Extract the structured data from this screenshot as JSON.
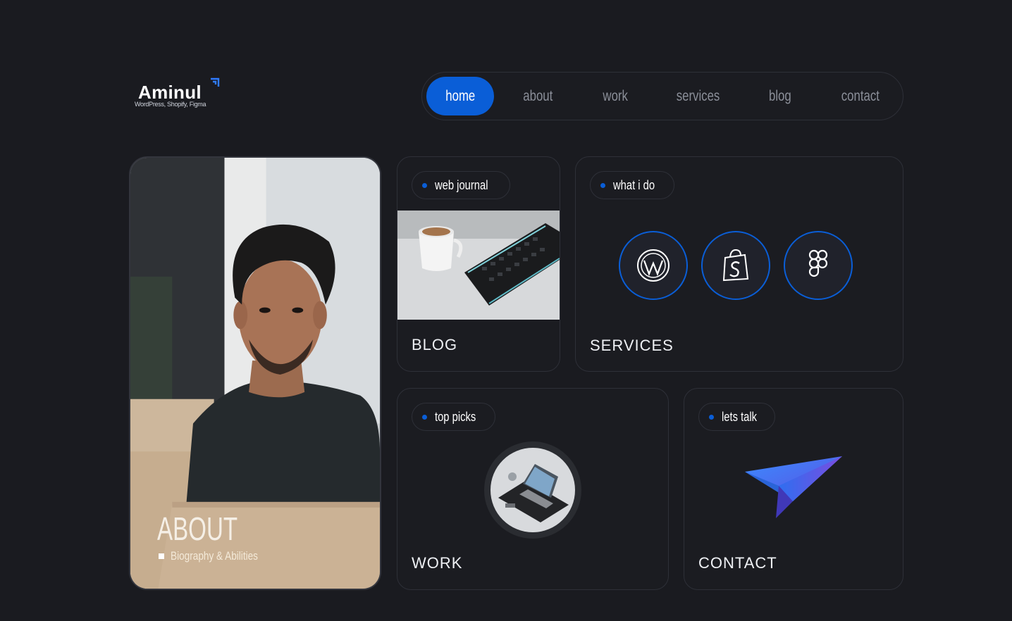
{
  "logo": {
    "name": "Aminul",
    "tagline": "WordPress, Shopify, Figma"
  },
  "nav": {
    "items": [
      {
        "label": "home",
        "active": true
      },
      {
        "label": "about",
        "active": false
      },
      {
        "label": "work",
        "active": false
      },
      {
        "label": "services",
        "active": false
      },
      {
        "label": "blog",
        "active": false
      },
      {
        "label": "contact",
        "active": false
      }
    ]
  },
  "about": {
    "title": "ABOUT",
    "subtitle": "Biography & Abilities"
  },
  "blog": {
    "pill": "web journal",
    "title": "BLOG"
  },
  "services": {
    "pill": "what i do",
    "title": "SERVICES",
    "icons": [
      "wordpress-icon",
      "shopify-icon",
      "figma-icon"
    ]
  },
  "work": {
    "pill": "top picks",
    "title": "WORK"
  },
  "contact": {
    "pill": "lets talk",
    "title": "CONTACT"
  },
  "colors": {
    "background": "#1a1b20",
    "accent": "#0a5ed7",
    "card_border": "#2e3038",
    "nav_inactive": "#8b8f99"
  }
}
